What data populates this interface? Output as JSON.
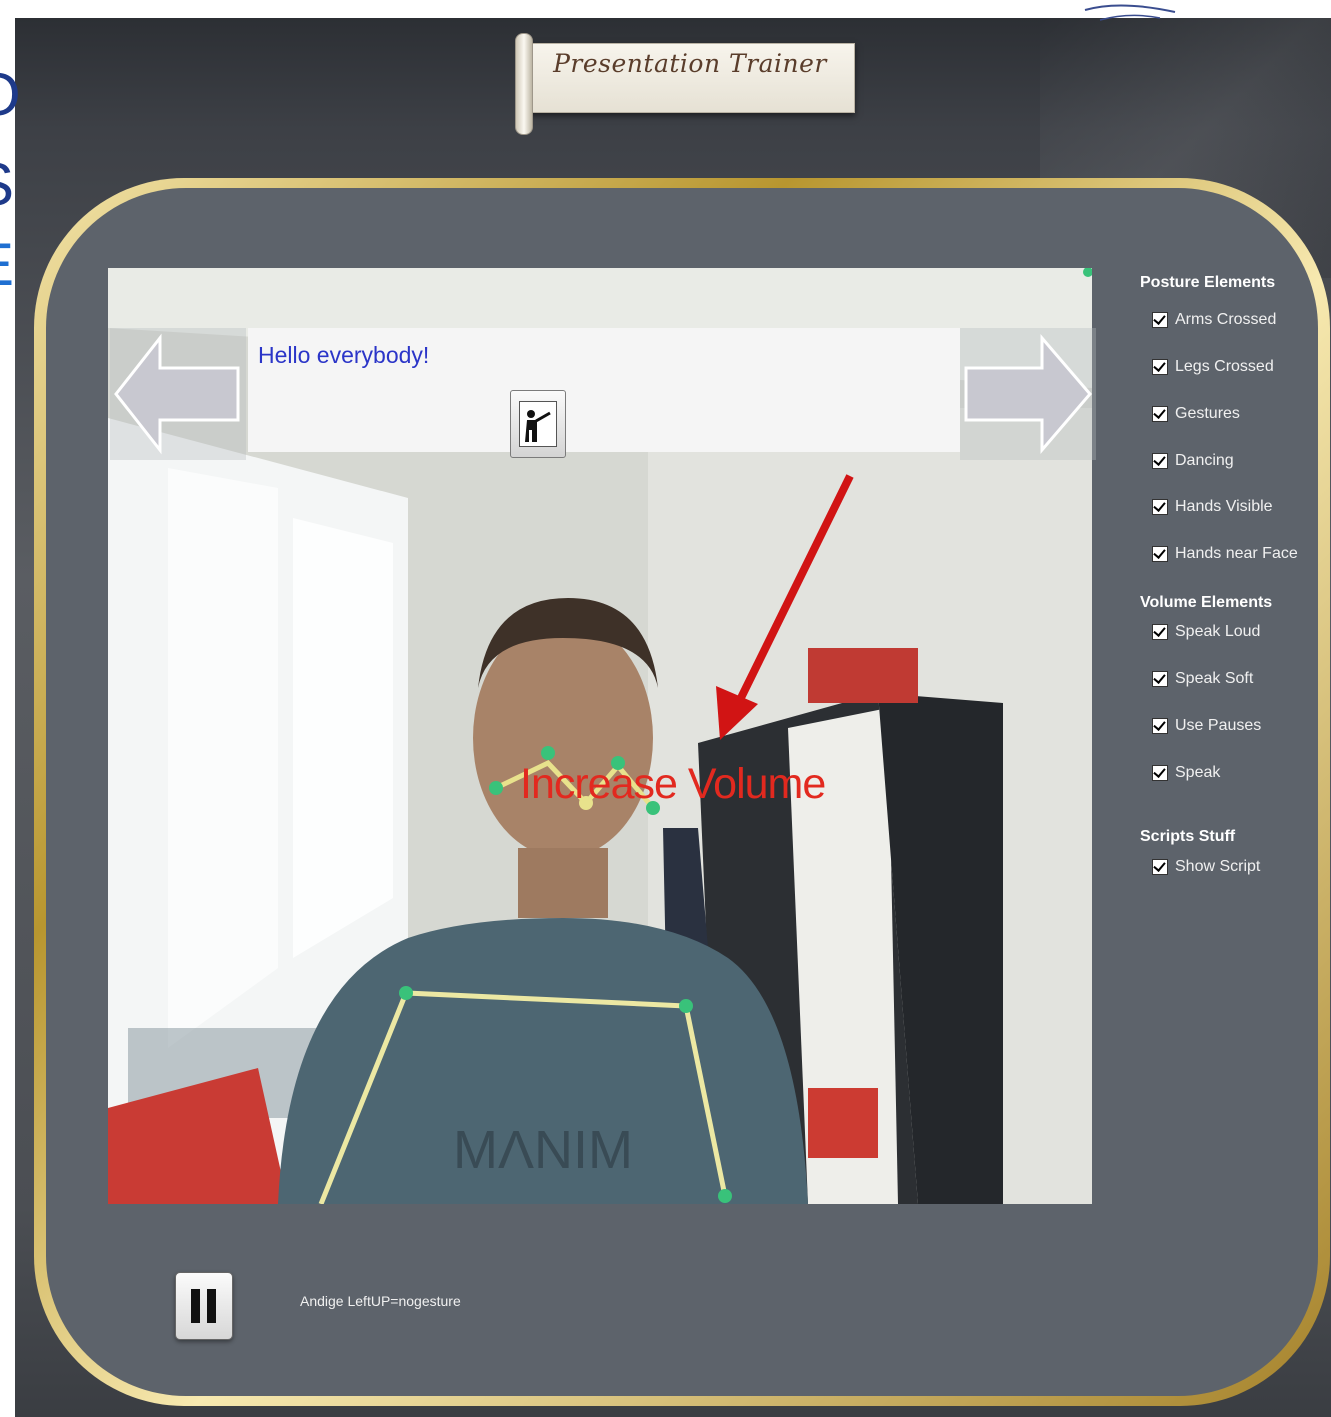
{
  "app": {
    "title": "Presentation Trainer"
  },
  "script": {
    "text": "Hello everybody!"
  },
  "feedback": {
    "message": "Increase Volume",
    "color": "#e2291f"
  },
  "settings": {
    "posture_heading": "Posture Elements",
    "posture": [
      {
        "label": "Arms Crossed",
        "checked": true
      },
      {
        "label": "Legs Crossed",
        "checked": true
      },
      {
        "label": "Gestures",
        "checked": true
      },
      {
        "label": "Dancing",
        "checked": true
      },
      {
        "label": "Hands Visible",
        "checked": true
      },
      {
        "label": "Hands near Face",
        "checked": true
      }
    ],
    "volume_heading": "Volume Elements",
    "volume": [
      {
        "label": "Speak Loud",
        "checked": true
      },
      {
        "label": "Speak Soft",
        "checked": true
      },
      {
        "label": "Use Pauses",
        "checked": true
      },
      {
        "label": "Speak",
        "checked": true
      }
    ],
    "scripts_heading": "Scripts Stuff",
    "scripts": [
      {
        "label": "Show Script",
        "checked": true
      }
    ]
  },
  "status": {
    "text": "Andige LeftUP=nogesture"
  },
  "icons": {
    "prev": "arrow-left-icon",
    "next": "arrow-right-icon",
    "gesture": "gesture-icon",
    "pause": "pause-icon"
  },
  "colors": {
    "frame_gold": "#c9a53a",
    "panel_bg": "#5d636b",
    "script_text": "#2b35c8"
  }
}
